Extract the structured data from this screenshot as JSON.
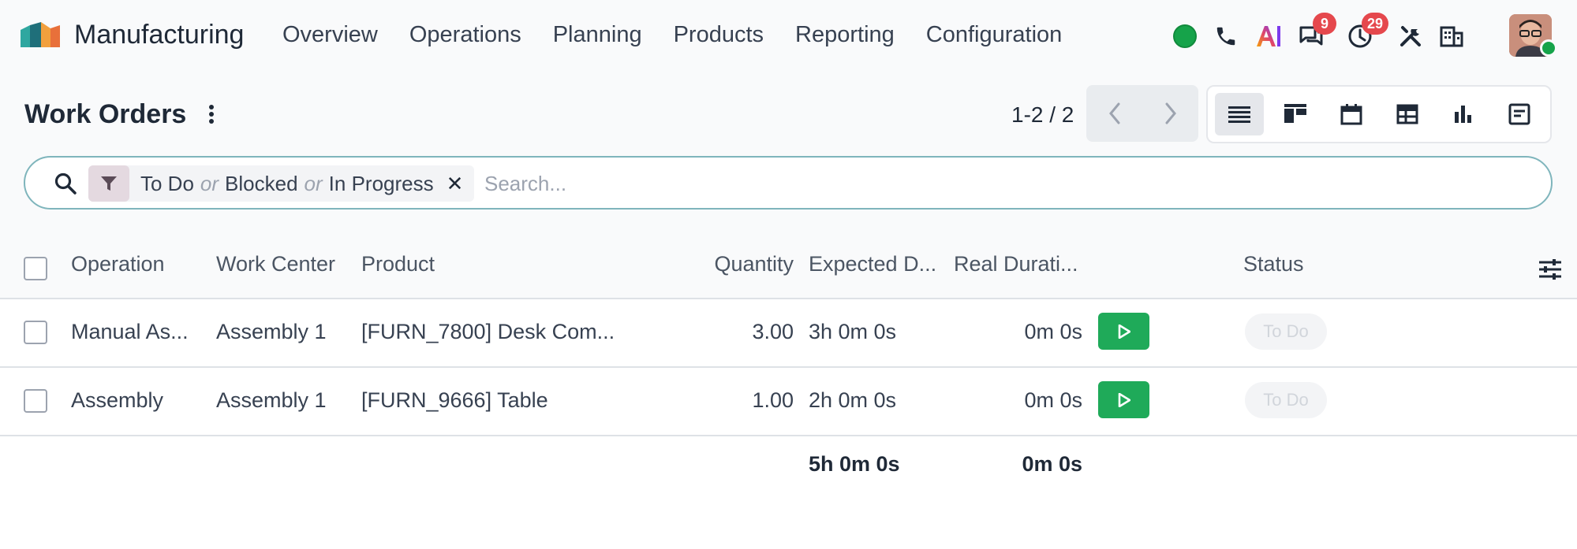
{
  "app": {
    "name": "Manufacturing"
  },
  "menu": [
    "Overview",
    "Operations",
    "Planning",
    "Products",
    "Reporting",
    "Configuration"
  ],
  "systray": {
    "messages_count": "9",
    "activities_count": "29",
    "ai_label": "AI"
  },
  "colors": {
    "accent": "#1faa59",
    "focus_border": "#7fb5bc",
    "badge": "#e5484d",
    "online": "#16a34a"
  },
  "page": {
    "title": "Work Orders",
    "pager": "1-2 / 2"
  },
  "views": [
    "list-view",
    "kanban-view",
    "calendar-view",
    "pivot-view",
    "graph-view",
    "activity-view"
  ],
  "search": {
    "facet_values": [
      "To Do",
      "Blocked",
      "In Progress"
    ],
    "facet_separator": "or",
    "placeholder": "Search..."
  },
  "table": {
    "columns": {
      "operation": "Operation",
      "work_center": "Work Center",
      "product": "Product",
      "quantity": "Quantity",
      "expected": "Expected D...",
      "real": "Real Durati...",
      "status": "Status"
    },
    "rows": [
      {
        "operation": "Manual As...",
        "work_center": "Assembly 1",
        "product": "[FURN_7800] Desk Com...",
        "quantity": "3.00",
        "expected": "3h 0m 0s",
        "real": "0m 0s",
        "status": "To Do"
      },
      {
        "operation": "Assembly",
        "work_center": "Assembly 1",
        "product": "[FURN_9666] Table",
        "quantity": "1.00",
        "expected": "2h 0m 0s",
        "real": "0m 0s",
        "status": "To Do"
      }
    ],
    "totals": {
      "expected": "5h 0m 0s",
      "real": "0m 0s"
    }
  }
}
